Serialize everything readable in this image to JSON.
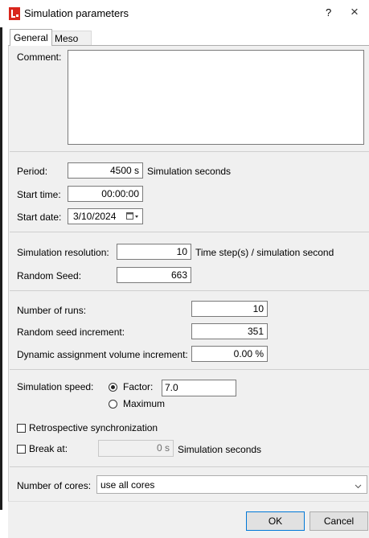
{
  "window": {
    "title": "Simulation parameters",
    "help": "?",
    "close": "×",
    "app_icon": "app-logo-icon",
    "close_icon": "close-icon"
  },
  "tabs": [
    {
      "label": "General",
      "active": true
    },
    {
      "label": "Meso",
      "active": false
    }
  ],
  "comment": {
    "label": "Comment:",
    "value": ""
  },
  "period": {
    "label": "Period:",
    "value": "4500 s",
    "unit": "Simulation seconds"
  },
  "start_time": {
    "label": "Start time:",
    "value": "00:00:00"
  },
  "start_date": {
    "label": "Start date:",
    "value": "3/10/2024",
    "icon": "calendar-dropdown-icon"
  },
  "resolution": {
    "label": "Simulation resolution:",
    "value": "10",
    "unit": "Time step(s) / simulation second"
  },
  "random_seed": {
    "label": "Random Seed:",
    "value": "663"
  },
  "number_of_runs": {
    "label": "Number of runs:",
    "value": "10"
  },
  "seed_increment": {
    "label": "Random seed increment:",
    "value": "351"
  },
  "dyn_assign": {
    "label": "Dynamic assignment volume increment:",
    "value": "0.00 %"
  },
  "sim_speed": {
    "label": "Simulation speed:",
    "factor_label": "Factor:",
    "factor_value": "7.0",
    "maximum_label": "Maximum",
    "selected": "factor"
  },
  "retro_sync": {
    "label": "Retrospective synchronization",
    "checked": false
  },
  "break_at": {
    "label": "Break at:",
    "value": "0 s",
    "unit": "Simulation seconds",
    "checked": false,
    "enabled": false
  },
  "cores": {
    "label": "Number of cores:",
    "value": "use all cores",
    "icon": "chevron-down-icon"
  },
  "buttons": {
    "ok": "OK",
    "cancel": "Cancel"
  },
  "colors": {
    "accent": "#0078d7",
    "panel": "#f0f0f0",
    "app_icon_red": "#d9261c"
  }
}
